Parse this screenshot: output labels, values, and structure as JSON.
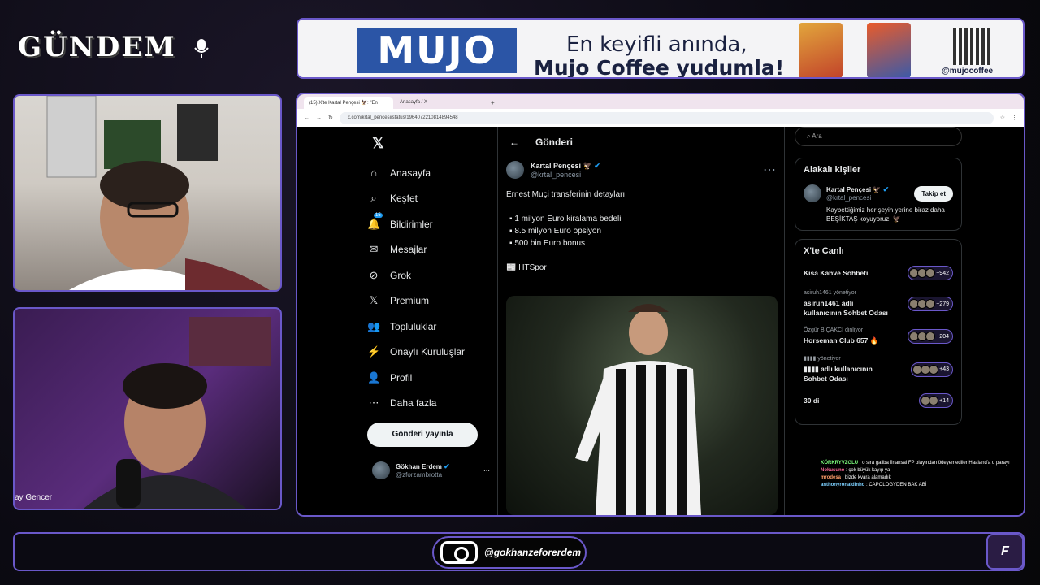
{
  "overlay": {
    "brand": "GÜNDEM",
    "instagram_handle": "@gokhanzeforerdem",
    "cam2_name": "ay Gencer",
    "corner_logo": "F"
  },
  "ad": {
    "logo": "MUJO",
    "line1": "En keyifli anında,",
    "line2": "Mujo Coffee yudumla!",
    "handle": "@mujocoffee"
  },
  "browser": {
    "tabs": [
      {
        "label": "(15) X'te Kartal Pençesi 🦅: \"En"
      },
      {
        "label": "Anasayfa / X"
      }
    ],
    "url": "x.com/krtal_pencesi/status/1964072210814894548"
  },
  "nav": {
    "items": [
      {
        "label": "Anasayfa",
        "icon": "home-icon"
      },
      {
        "label": "Keşfet",
        "icon": "search-icon"
      },
      {
        "label": "Bildirimler",
        "icon": "bell-icon",
        "badge": "15"
      },
      {
        "label": "Mesajlar",
        "icon": "mail-icon"
      },
      {
        "label": "Grok",
        "icon": "grok-icon"
      },
      {
        "label": "Premium",
        "icon": "x-icon"
      },
      {
        "label": "Topluluklar",
        "icon": "people-icon"
      },
      {
        "label": "Onaylı Kuruluşlar",
        "icon": "bolt-icon"
      },
      {
        "label": "Profil",
        "icon": "person-icon"
      },
      {
        "label": "Daha fazla",
        "icon": "more-icon"
      }
    ],
    "post_button": "Gönderi yayınla",
    "profile_name": "Gökhan Erdem",
    "profile_handle": "@zforzambrotta"
  },
  "post": {
    "header": "Gönderi",
    "author": "Kartal Pençesi 🦅",
    "handle": "@krtal_pencesi",
    "text": "Ernest Muçi transferinin detayları:",
    "bullets": [
      "1 milyon Euro kiralama bedeli",
      "8.5 milyon Euro opsiyon",
      "500 bin Euro bonus"
    ],
    "source": "HTSpor"
  },
  "sidebar": {
    "search_placeholder": "Ara",
    "related_title": "Alakalı kişiler",
    "related_name": "Kartal Pençesi 🦅",
    "related_handle": "@krtal_pencesi",
    "follow_label": "Takip et",
    "related_bio": "Kaybettiğimiz her şeyin yerine biraz daha BEŞİKTAŞ koyuyoruz! 🦅",
    "live_title": "X'te Canlı",
    "live": [
      {
        "host": "",
        "title": "Kısa Kahve Sohbeti",
        "count": "+942"
      },
      {
        "host": "asiruh1461 yönetiyor",
        "title": "asiruh1461 adlı kullanıcının Sohbet Odası",
        "count": "+279"
      },
      {
        "host": "Özgür BIÇAKCI dinliyor",
        "title": "Horseman Club 657 🔥",
        "count": "+204"
      },
      {
        "host": "▮▮▮▮ yönetiyor",
        "title": "▮▮▮▮ adlı kullanıcının Sohbet Odası",
        "count": "+43"
      },
      {
        "host": "",
        "title": "30 di",
        "count": "+14"
      }
    ]
  },
  "chat": [
    {
      "user": "KÖRKRYVZGLU",
      "msg": ": o sıra galiba finansal FP olayından ödeyemediler Haaland'a o parayı"
    },
    {
      "user": "Nokusuno",
      "msg": ": çok büyük kayıp ya"
    },
    {
      "user": "mrodesa",
      "msg": ": bizde kvara alamadık"
    },
    {
      "user": "anthonyronaldinho",
      "msg": ": CAPOLOGYDEN BAK ABİ"
    }
  ],
  "colors": {
    "accent": "#6a58c9",
    "x_blue": "#1d9bf0"
  }
}
